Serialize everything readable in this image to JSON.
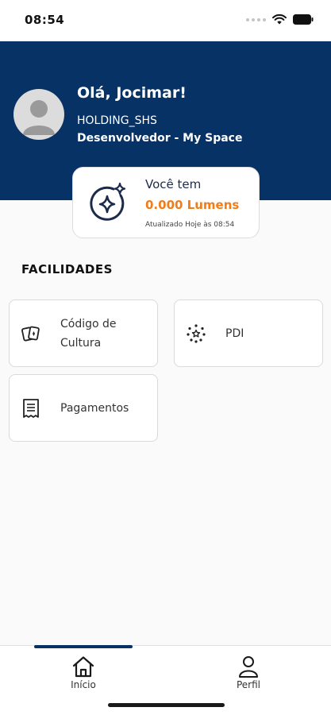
{
  "status_bar": {
    "time": "08:54"
  },
  "header": {
    "greeting": "Olá, Jocimar!",
    "company": "HOLDING_SHS",
    "role": "Desenvolvedor - My Space"
  },
  "lumens": {
    "title": "Você tem",
    "value": "0.000 Lumens",
    "updated": "Atualizado Hoje às 08:54"
  },
  "facilities": {
    "title": "FACILIDADES",
    "items": [
      {
        "label_line1": "Código de",
        "label_line2": "Cultura",
        "icon": "cards-icon"
      },
      {
        "label": "PDI",
        "icon": "stars-circle-icon"
      },
      {
        "label": "Pagamentos",
        "icon": "receipt-icon"
      }
    ]
  },
  "bottom_nav": {
    "items": [
      {
        "label": "Início",
        "icon": "home-icon",
        "active": true
      },
      {
        "label": "Perfil",
        "icon": "user-icon",
        "active": false
      }
    ]
  },
  "colors": {
    "header": "#073265",
    "accent": "#f07d1a"
  }
}
